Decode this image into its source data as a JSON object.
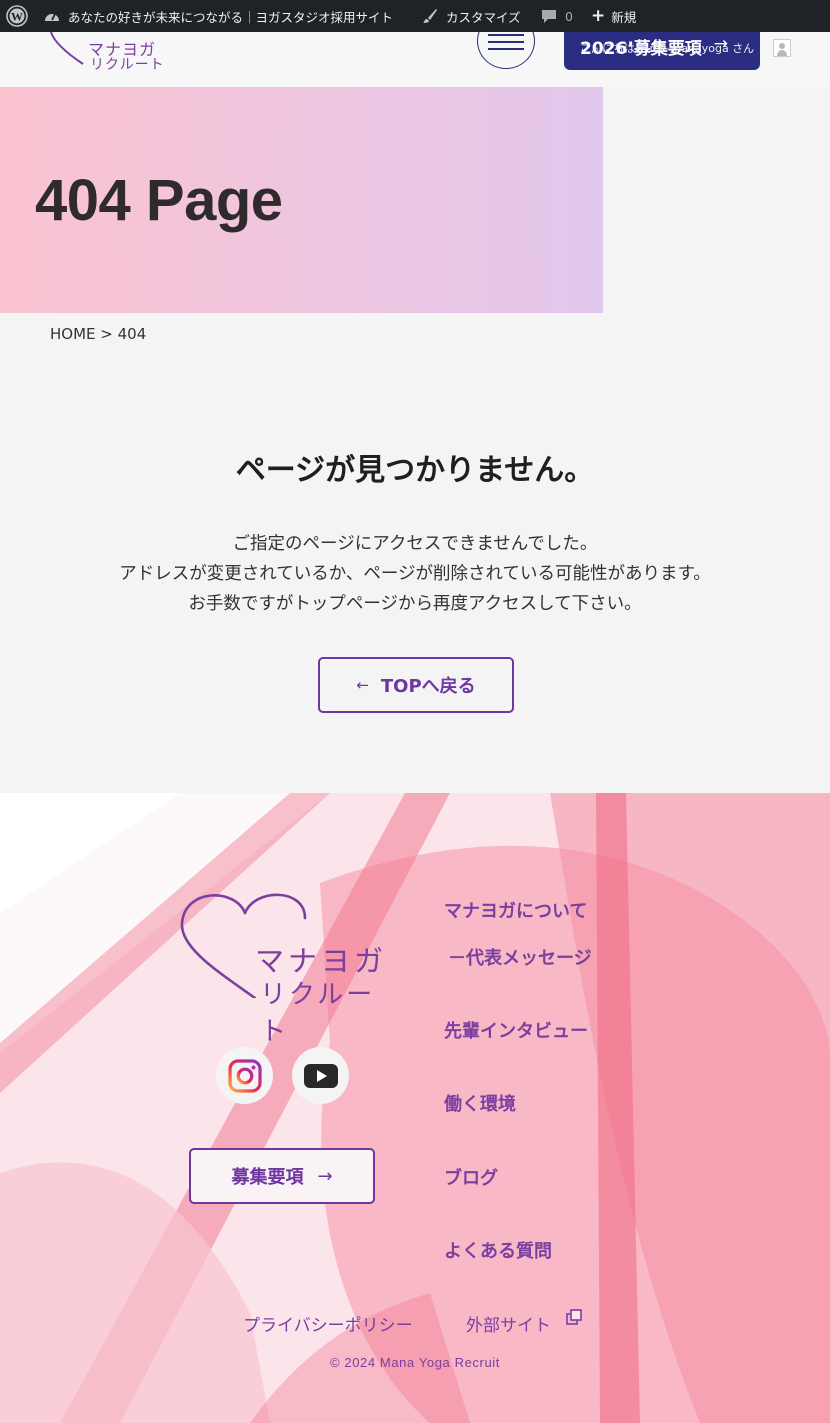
{
  "adminbar": {
    "site_title": "あなたの好きが未来につながる｜ヨガスタジオ採用サイト",
    "customize": "カスタマイズ",
    "comment_count": "0",
    "new": "新規",
    "howdy": "こんにちは、 mk-manayoga さん"
  },
  "header": {
    "logo_line1": "マナヨガ",
    "logo_line2": "リクルート",
    "recruit_label": "2026’募集要項",
    "arrow": "→"
  },
  "hero": {
    "title": "404 Page"
  },
  "breadcrumb": {
    "home": "HOME",
    "sep": " > ",
    "current": "404"
  },
  "notfound": {
    "title": "ページが見つかりません。",
    "lines": [
      "ご指定のページにアクセスできませんでした。",
      "アドレスが変更されているか、ページが削除されている可能性があります。",
      "お手数ですがトップページから再度アクセスして下さい。"
    ],
    "back_label": "TOPへ戻る",
    "back_arrow": "←"
  },
  "footer": {
    "logo_line1": "マナヨガ",
    "logo_line2": "リクルート",
    "recruit_label": "募集要項",
    "recruit_arrow": "→",
    "nav": [
      "マナヨガについて",
      "－代表メッセージ",
      "先輩インタビュー",
      "働く環境",
      "ブログ",
      "よくある質問"
    ],
    "privacy": "プライバシーポリシー",
    "external": "外部サイト",
    "copyright": "© 2024 Mana Yoga Recruit"
  },
  "colors": {
    "brand_purple": "#7b3fa0",
    "navy": "#2b2d82",
    "adminbar": "#1d2327",
    "footer_pink": "#f27b92"
  },
  "icons": [
    "wordpress-icon",
    "dashboard-icon",
    "brush-icon",
    "comment-icon",
    "plus-icon",
    "heart-logo-icon",
    "instagram-icon",
    "youtube-icon",
    "external-link-icon",
    "hamburger-icon",
    "avatar-icon"
  ]
}
